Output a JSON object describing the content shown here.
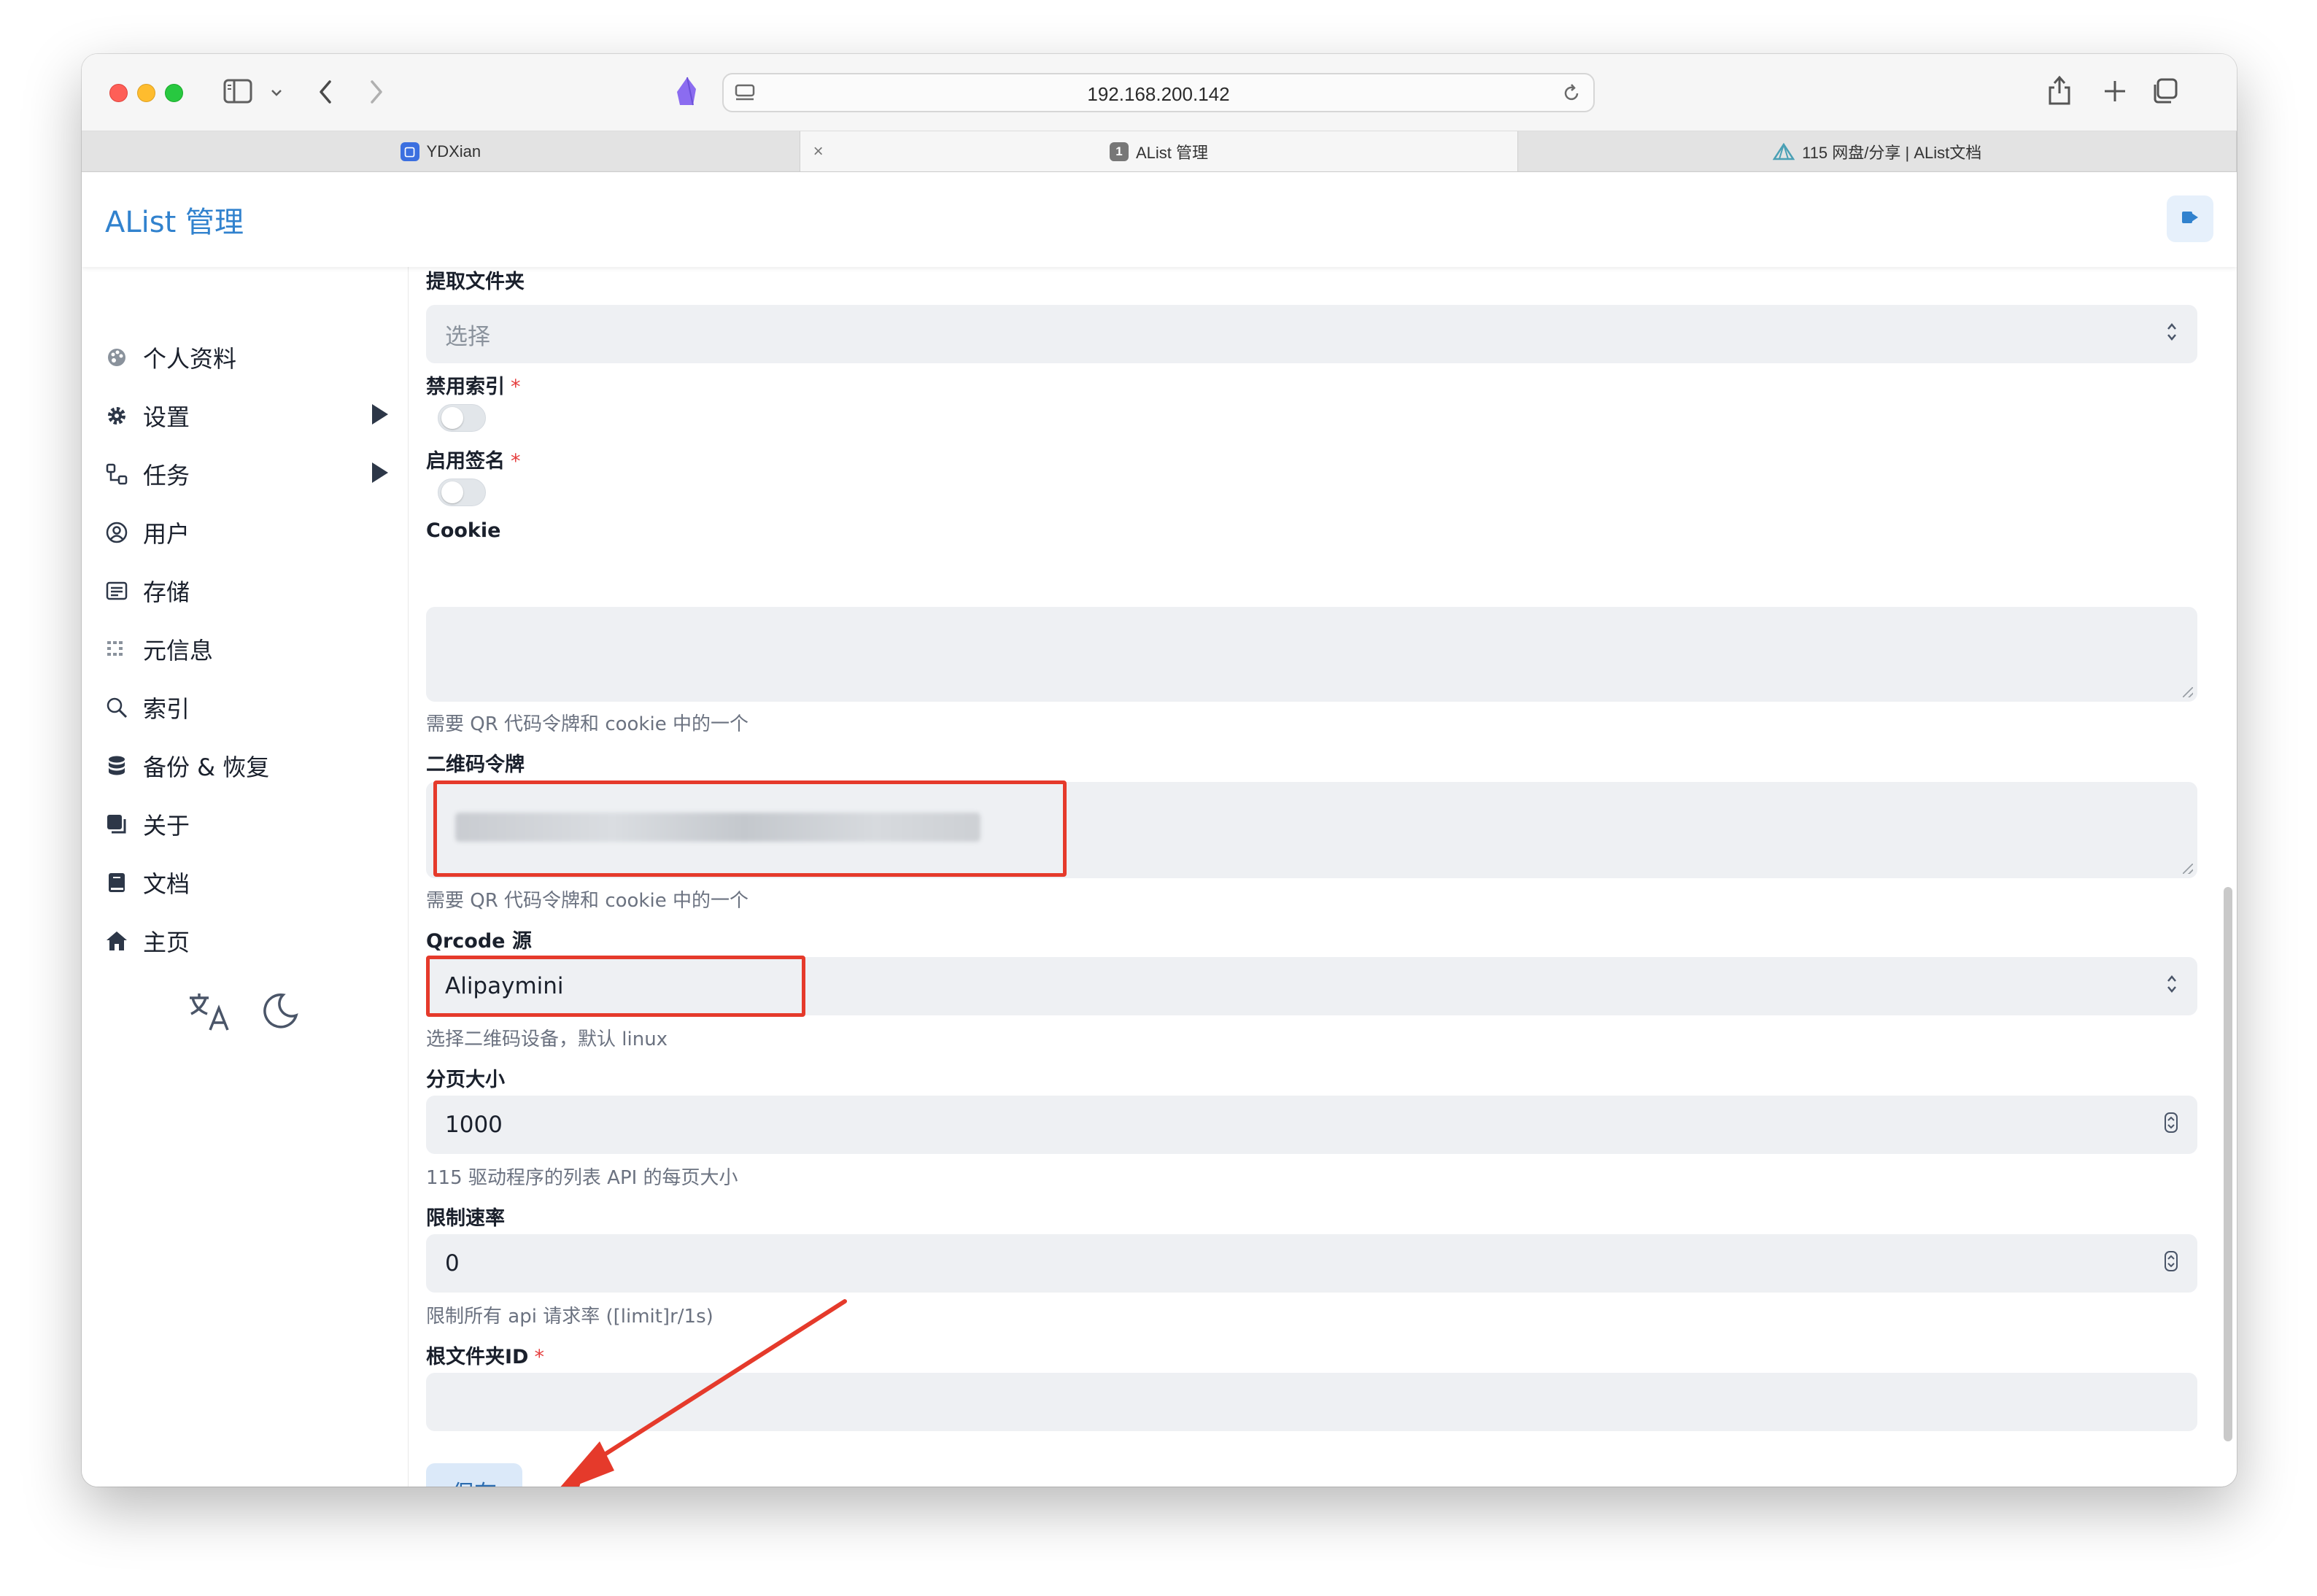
{
  "browser": {
    "address": "192.168.200.142",
    "tabs": [
      {
        "title": "YDXian",
        "active": false,
        "favicon": "app-square-icon",
        "color": "#3b6fe0"
      },
      {
        "title": "AList 管理",
        "active": true,
        "favicon": "digit-one-icon",
        "color": "#777777"
      },
      {
        "title": "115 网盘/分享 | AList文档",
        "active": false,
        "favicon": "alist-logo-icon",
        "color": "#4aa0b5"
      }
    ]
  },
  "app": {
    "title": "AList 管理",
    "accent": "#3182ce"
  },
  "sidebar": {
    "items": [
      {
        "label": "个人资料",
        "icon": "palette-icon"
      },
      {
        "label": "设置",
        "icon": "gear-icon",
        "expandable": true
      },
      {
        "label": "任务",
        "icon": "tasks-icon",
        "expandable": true
      },
      {
        "label": "用户",
        "icon": "user-circle-icon"
      },
      {
        "label": "存储",
        "icon": "storage-icon"
      },
      {
        "label": "元信息",
        "icon": "metadata-icon"
      },
      {
        "label": "索引",
        "icon": "search-icon"
      },
      {
        "label": "备份 & 恢复",
        "icon": "database-icon"
      },
      {
        "label": "关于",
        "icon": "copy-icon"
      },
      {
        "label": "文档",
        "icon": "book-icon"
      },
      {
        "label": "主页",
        "icon": "home-icon"
      }
    ]
  },
  "form": {
    "extract_folder": {
      "label": "提取文件夹",
      "placeholder": "选择"
    },
    "disable_index": {
      "label": "禁用索引",
      "required": "*",
      "on": false
    },
    "enable_sign": {
      "label": "启用签名",
      "required": "*",
      "on": false
    },
    "cookie": {
      "label": "Cookie",
      "help": "需要 QR 代码令牌和 cookie 中的一个"
    },
    "qr_token": {
      "label": "二维码令牌",
      "help": "需要 QR 代码令牌和 cookie 中的一个"
    },
    "qrcode_source": {
      "label": "Qrcode 源",
      "value": "Alipaymini",
      "help": "选择二维码设备，默认 linux"
    },
    "page_size": {
      "label": "分页大小",
      "value": "1000",
      "help": "115 驱动程序的列表 API 的每页大小"
    },
    "rate_limit": {
      "label": "限制速率",
      "value": "0",
      "help": "限制所有 api 请求率 ([limit]r/1s)"
    },
    "root_folder_id": {
      "label": "根文件夹ID",
      "required": "*"
    },
    "save_label": "保存"
  },
  "annotation_color": "#e53a2b"
}
